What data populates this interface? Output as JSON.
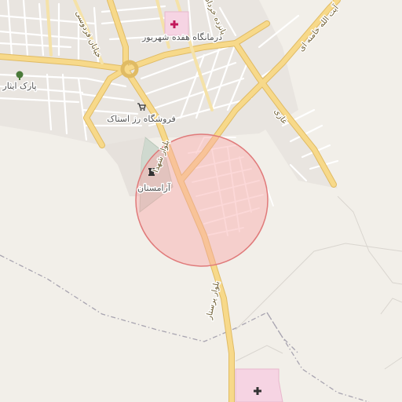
{
  "map": {
    "place_labels": {
      "clinic_north": "درمانگاه هفده شهریور",
      "park": "پارک ایثار",
      "store": "فروشگاه رز استاک",
      "cemetery": "آرامستان"
    },
    "road_labels": {
      "shohada": "بلوار شهدا",
      "persestar": "بلوار پرستار",
      "khamenei": "آیت الله خامنه ای",
      "ferdowsi": "خیابان فردوسی",
      "khordad": "پانزده خرداد",
      "ghazi": "غازی"
    },
    "icons": [
      "hospital-icon",
      "tree-icon",
      "shop-icon",
      "cemetery-icon"
    ],
    "colors": {
      "background": "#f2efe9",
      "major_road": "#f7d98a",
      "major_road_casing": "#e0bb64",
      "minor_road": "#ffffff",
      "minor_road_casing": "#d8d3cb",
      "boundary": "#a8a4b0",
      "radius_fill": "#f8a8a8",
      "radius_stroke": "#e07a7a",
      "hospital": "#f6d4e3",
      "cemetery": "#cfd9cf"
    }
  }
}
